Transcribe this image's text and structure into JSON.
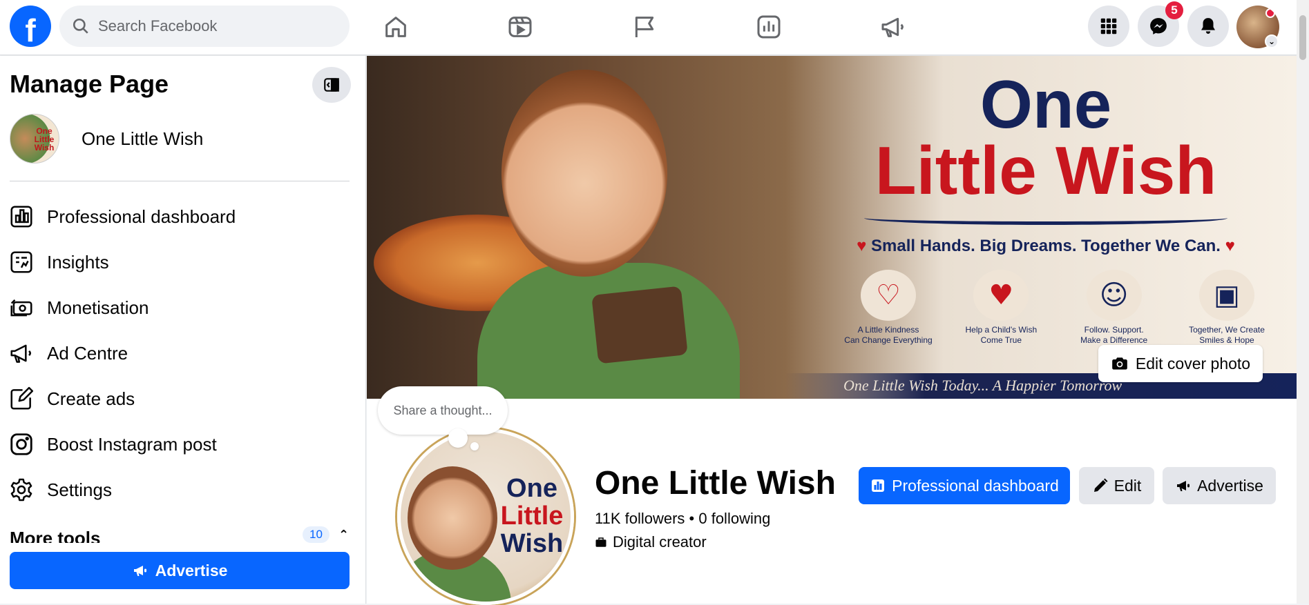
{
  "app": {
    "logo_letter": "f",
    "search_placeholder": "Search Facebook",
    "nav_tabs": [
      {
        "icon": "home-icon"
      },
      {
        "icon": "video-icon"
      },
      {
        "icon": "flag-icon"
      },
      {
        "icon": "insights-icon"
      },
      {
        "icon": "megaphone-icon"
      }
    ],
    "messenger_badge": "5",
    "colors": {
      "brand_blue": "#0866ff",
      "badge_red": "#e41e3f",
      "background": "#f0f2f5"
    }
  },
  "sidebar": {
    "title": "Manage Page",
    "page_name": "One Little Wish",
    "page_pic_text": "One Little Wish",
    "items": [
      {
        "label": "Professional dashboard",
        "icon": "dashboard-icon"
      },
      {
        "label": "Insights",
        "icon": "insights-icon"
      },
      {
        "label": "Monetisation",
        "icon": "money-icon"
      },
      {
        "label": "Ad Centre",
        "icon": "megaphone-icon"
      },
      {
        "label": "Create ads",
        "icon": "edit-icon"
      },
      {
        "label": "Boost Instagram post",
        "icon": "instagram-icon"
      },
      {
        "label": "Settings",
        "icon": "gear-icon"
      }
    ],
    "more_tools_label": "More tools",
    "more_tools_count": "10",
    "advertise_label": "Advertise"
  },
  "cover": {
    "title_line1": "One",
    "title_line2": "Little Wish",
    "tagline": "Small Hands. Big Dreams. Together We Can.",
    "features": [
      {
        "icon": "heart-icon",
        "caption": "A Little Kindness\nCan Change Everything"
      },
      {
        "icon": "heart-hands-icon",
        "caption": "Help a Child's Wish\nCome True"
      },
      {
        "icon": "people-icon",
        "caption": "Follow. Support.\nMake a Difference"
      },
      {
        "icon": "gift-icon",
        "caption": "Together, We Create\nSmiles & Hope"
      }
    ],
    "bottom_text": "One Little Wish Today... A Happier Tomorrow",
    "edit_label": "Edit cover photo"
  },
  "profile": {
    "thought_placeholder": "Share a thought...",
    "pic_line1": "One",
    "pic_line2": "Little",
    "pic_line3": "Wish",
    "name": "One Little Wish",
    "stats": "11K followers • 0 following",
    "category": "Digital creator",
    "actions": {
      "dashboard": "Professional dashboard",
      "edit": "Edit",
      "advertise": "Advertise"
    }
  }
}
